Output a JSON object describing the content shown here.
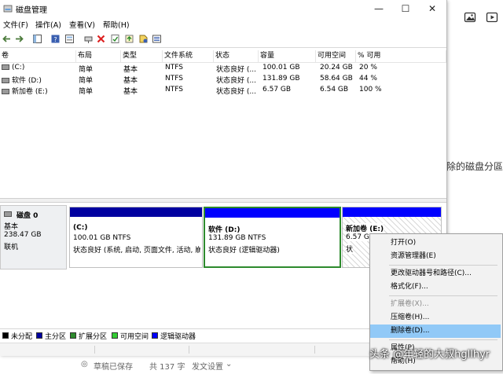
{
  "window": {
    "title": "磁盘管理",
    "controls": {
      "minimize": "—",
      "maximize": "☐",
      "close": "✕"
    }
  },
  "menu": [
    "文件(F)",
    "操作(A)",
    "查看(V)",
    "帮助(H)"
  ],
  "volume_table": {
    "headers": [
      "卷",
      "布局",
      "类型",
      "文件系统",
      "状态",
      "容量",
      "可用空间",
      "% 可用"
    ],
    "rows": [
      [
        "(C:)",
        "简单",
        "基本",
        "NTFS",
        "状态良好 (...",
        "100.01 GB",
        "20.24 GB",
        "20 %"
      ],
      [
        "软件 (D:)",
        "简单",
        "基本",
        "NTFS",
        "状态良好 (...",
        "131.89 GB",
        "58.64 GB",
        "44 %"
      ],
      [
        "新加卷 (E:)",
        "简单",
        "基本",
        "NTFS",
        "状态良好 (...",
        "6.57 GB",
        "6.54 GB",
        "100 %"
      ]
    ]
  },
  "disk": {
    "name": "磁盘 0",
    "type": "基本",
    "size": "238.47 GB",
    "status": "联机"
  },
  "partitions": [
    {
      "label": "(C:)",
      "size": "100.01 GB NTFS",
      "status": "状态良好 (系统, 启动, 页面文件, 活动, 崩"
    },
    {
      "label": "软件  (D:)",
      "size": "131.89 GB NTFS",
      "status": "状态良好 (逻辑驱动器)"
    },
    {
      "label": "新加卷  (E:)",
      "size": "6.57 GB",
      "status": "状"
    }
  ],
  "legend": [
    {
      "label": "未分配",
      "color": "#000000"
    },
    {
      "label": "主分区",
      "color": "#0000a0"
    },
    {
      "label": "扩展分区",
      "color": "#2d8a2d"
    },
    {
      "label": "可用空间",
      "color": "#33cc33"
    },
    {
      "label": "逻辑驱动器",
      "color": "#0000ff"
    }
  ],
  "context_menu": [
    {
      "label": "打开(O)",
      "enabled": true
    },
    {
      "label": "资源管理器(E)",
      "enabled": true
    },
    {
      "label": "更改驱动器号和路径(C)...",
      "enabled": true
    },
    {
      "label": "格式化(F)...",
      "enabled": true
    },
    {
      "label": "扩展卷(X)...",
      "enabled": false
    },
    {
      "label": "压缩卷(H)...",
      "enabled": true
    },
    {
      "label": "删除卷(D)...",
      "enabled": true,
      "highlighted": true
    },
    {
      "label": "属性(P)",
      "enabled": true
    },
    {
      "label": "帮助(H)",
      "enabled": true
    }
  ],
  "editor": {
    "partial_text": "删除的磁盘分區",
    "saved_status": "草稿已保存",
    "word_count": "共 137 字",
    "publish_settings": "发文设置"
  },
  "watermark": "头条 @年轻的大叔hgllhyr"
}
